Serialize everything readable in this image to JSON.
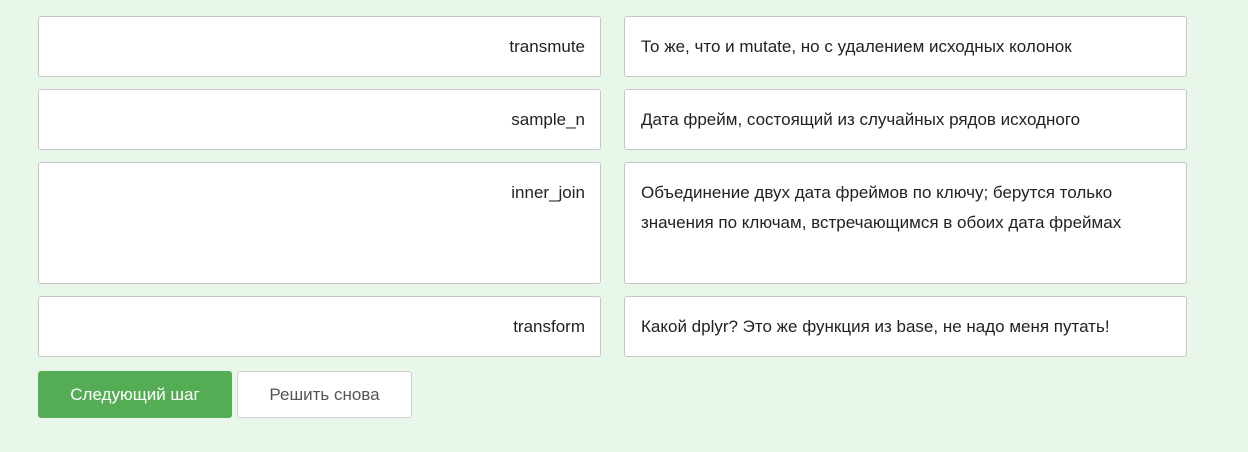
{
  "matching": {
    "rows": [
      {
        "term": "transmute",
        "definition": "То же, что и mutate, но с удалением исходных колонок"
      },
      {
        "term": "sample_n",
        "definition": "Дата фрейм, состоящий из случайных рядов исходного"
      },
      {
        "term": "inner_join",
        "definition": "Объединение двух дата фреймов по ключу; берутся только значения по ключам, встречающимся в обоих дата фреймах"
      },
      {
        "term": "transform",
        "definition": "Какой dplyr? Это же функция из base, не надо меня путать!"
      }
    ]
  },
  "actions": {
    "next_step_label": "Следующий шаг",
    "retry_label": "Решить снова"
  },
  "colors": {
    "background": "#e9f7ea",
    "primary_button": "#54ad54",
    "cell_border": "#c7c7c7"
  }
}
